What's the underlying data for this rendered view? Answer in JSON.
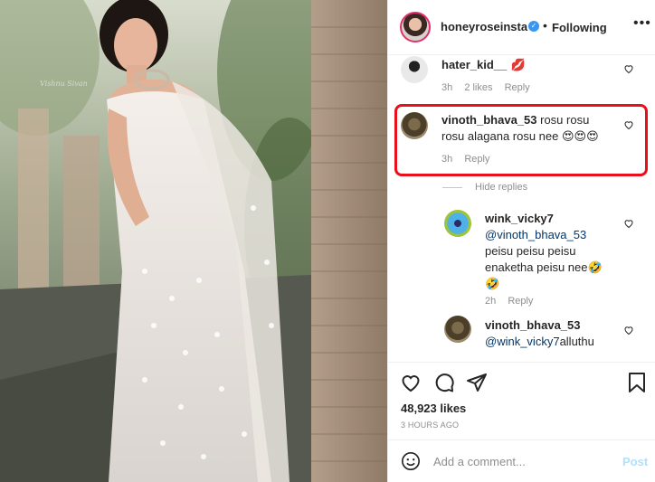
{
  "post": {
    "username": "honeyroseinsta",
    "verified_icon": "verified-check-icon",
    "follow_status": "Following",
    "more_icon": "more-options-icon",
    "photo_watermark": "Vishnu Sivan"
  },
  "comments": [
    {
      "username": "hater_kid__",
      "text": "💋",
      "time": "3h",
      "likes": "2 likes",
      "reply": "Reply"
    },
    {
      "username": "vinoth_bhava_53",
      "text": "rosu rosu rosu alagana rosu nee 😍😍😍",
      "text_line1": "rosu rosu",
      "text_line2": "rosu alagana rosu nee 😍😍😍",
      "time": "3h",
      "reply": "Reply",
      "highlighted": true,
      "highlight_color": "#e8101b"
    }
  ],
  "hide_replies": "Hide replies",
  "replies": [
    {
      "username": "wink_vicky7",
      "mention": "@vinoth_bhava_53",
      "text_line1": "peisu peisu peisu",
      "text_line2": "enaketha peisu nee🤣",
      "text_line3": "🤣",
      "time": "2h",
      "reply": "Reply"
    },
    {
      "username": "vinoth_bhava_53",
      "mention": "@wink_vicky7",
      "text": "alluthu"
    }
  ],
  "actions": {
    "like_icon": "heart-icon",
    "comment_icon": "comment-icon",
    "share_icon": "share-icon",
    "save_icon": "bookmark-icon",
    "likes": "48,923 likes",
    "timestamp": "3 HOURS AGO"
  },
  "add_comment": {
    "placeholder": "Add a comment...",
    "post_label": "Post",
    "emoji_icon": "emoji-icon"
  },
  "colors": {
    "link": "#00376b",
    "muted": "#8e8e8e",
    "verified": "#3897f0",
    "post_disabled": "#b2dffc"
  }
}
